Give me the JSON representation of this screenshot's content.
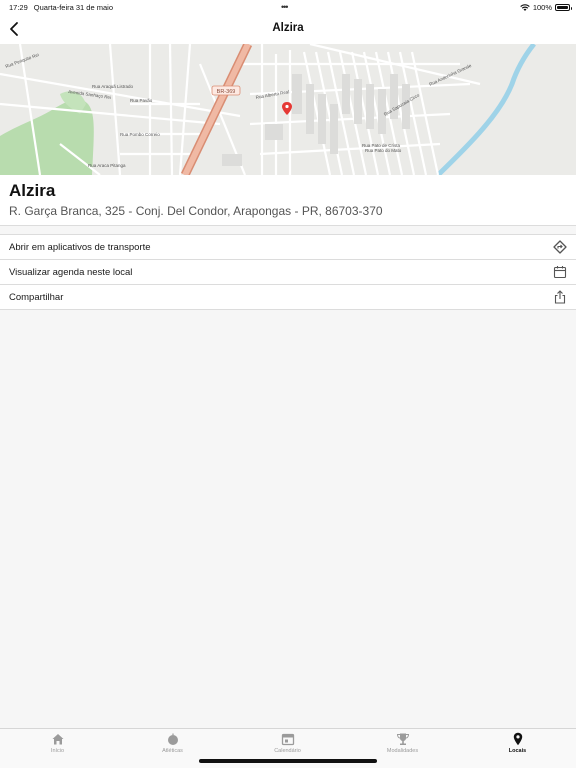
{
  "status_bar": {
    "time": "17:29",
    "date": "Quarta-feira 31 de maio",
    "dots": "•••",
    "battery": "100%"
  },
  "nav": {
    "title": "Alzira",
    "back_icon": "chevron-left-icon"
  },
  "map": {
    "marker_color": "#e53935",
    "highway_color": "#e8a087",
    "park_color": "#b8dcae",
    "river_color": "#9fd3e8",
    "highway_label": "BR-369",
    "street_labels": [
      "Avenida Sanhaço Rei",
      "Rua Pavão",
      "Rua Araquã Listrado",
      "Rua Alberto Real",
      "Rua Pato do Mato",
      "Rua Sapucaia Circo",
      "Rua Andorinha Grande",
      "Rua Pombo Correio",
      "Rua Araca Pitanga",
      "Rua Pato de Crista",
      "Rua Periquito Rei"
    ]
  },
  "place": {
    "name": "Alzira",
    "address": "R. Garça Branca, 325 - Conj. Del Condor, Arapongas - PR, 86703-370"
  },
  "actions": [
    {
      "label": "Abrir em aplicativos de transporte",
      "icon": "directions-icon"
    },
    {
      "label": "Visualizar agenda neste local",
      "icon": "calendar-icon"
    },
    {
      "label": "Compartilhar",
      "icon": "share-icon"
    }
  ],
  "tabs": [
    {
      "label": "Início",
      "icon": "home-icon",
      "active": false
    },
    {
      "label": "Atléticas",
      "icon": "ball-icon",
      "active": false
    },
    {
      "label": "Calendário",
      "icon": "calendar-icon",
      "active": false
    },
    {
      "label": "Modalidades",
      "icon": "trophy-icon",
      "active": false
    },
    {
      "label": "Locais",
      "icon": "location-pin-icon",
      "active": true
    }
  ],
  "colors": {
    "active_tab": "#111111",
    "inactive_tab": "#9b9b9b",
    "separator": "#dcdcdc"
  }
}
